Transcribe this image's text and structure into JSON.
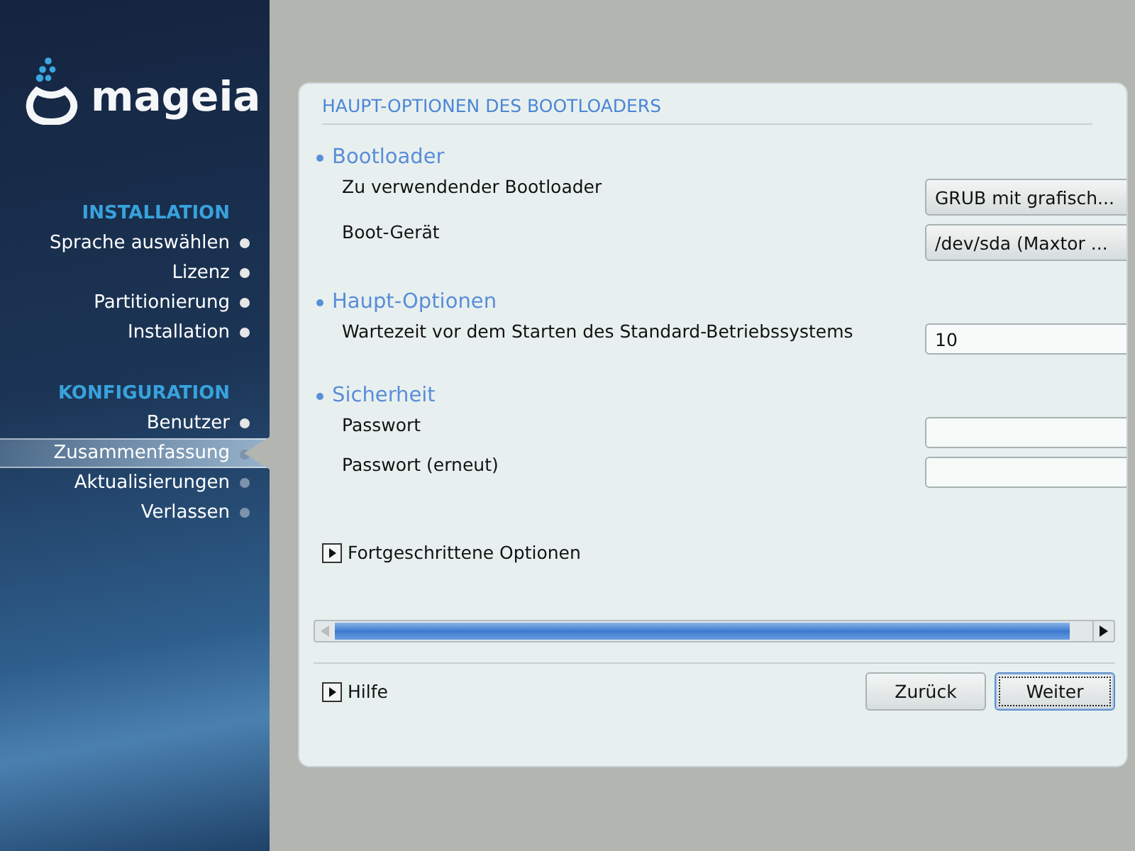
{
  "logo": {
    "text": "mageia"
  },
  "sidebar": {
    "groups": [
      {
        "title": "INSTALLATION",
        "items": [
          {
            "label": "Sprache auswählen",
            "done": true,
            "selected": false
          },
          {
            "label": "Lizenz",
            "done": true,
            "selected": false
          },
          {
            "label": "Partitionierung",
            "done": true,
            "selected": false
          },
          {
            "label": "Installation",
            "done": true,
            "selected": false
          }
        ]
      },
      {
        "title": "KONFIGURATION",
        "items": [
          {
            "label": "Benutzer",
            "done": true,
            "selected": false
          },
          {
            "label": "Zusammenfassung",
            "done": false,
            "selected": true
          },
          {
            "label": "Aktualisierungen",
            "done": false,
            "selected": false
          },
          {
            "label": "Verlassen",
            "done": false,
            "selected": false
          }
        ]
      }
    ]
  },
  "panel": {
    "title": "HAUPT-OPTIONEN DES BOOTLOADERS",
    "sections": [
      {
        "heading": "Bootloader",
        "rows": [
          {
            "kind": "dropdown",
            "label": "Zu verwendender Bootloader",
            "value": "GRUB mit grafisch..."
          },
          {
            "kind": "dropdown",
            "label": "Boot-Gerät",
            "value": "/dev/sda (Maxtor ..."
          }
        ]
      },
      {
        "heading": "Haupt-Optionen",
        "rows": [
          {
            "kind": "field",
            "label": "Wartezeit vor dem Starten des Standard-Betriebssystems",
            "value": "10"
          }
        ]
      },
      {
        "heading": "Sicherheit",
        "rows": [
          {
            "kind": "password",
            "label": "Passwort"
          },
          {
            "kind": "password",
            "label": "Passwort (erneut)"
          }
        ]
      }
    ],
    "expander": {
      "label": "Fortgeschrittene Optionen",
      "expanded": false
    },
    "help": {
      "label": "Hilfe",
      "expanded": false
    },
    "buttons": [
      {
        "label": "Zurück",
        "focused": false
      },
      {
        "label": "Weiter",
        "focused": true
      }
    ]
  }
}
